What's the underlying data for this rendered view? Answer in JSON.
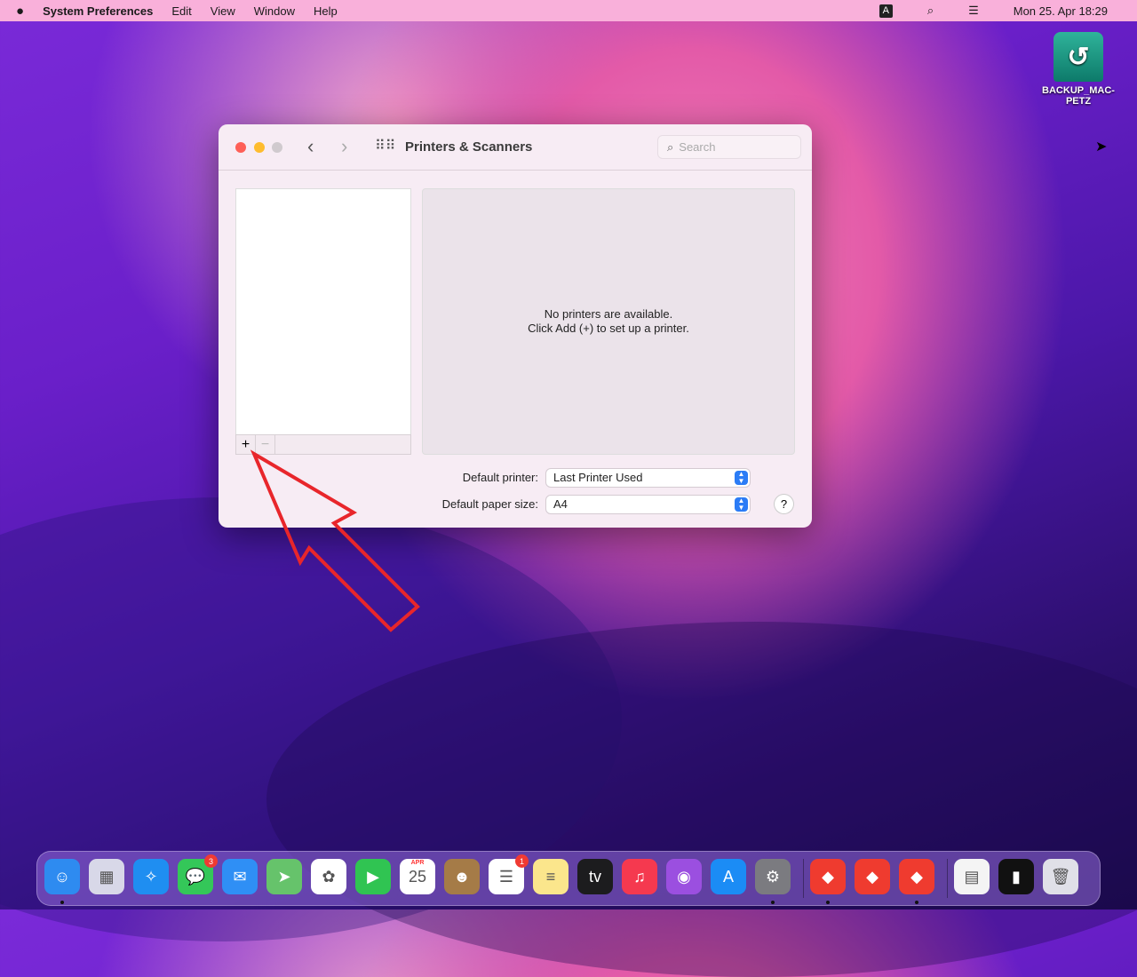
{
  "menubar": {
    "app": "System Preferences",
    "items": [
      "Edit",
      "View",
      "Window",
      "Help"
    ],
    "input_badge": "A",
    "clock": "Mon 25. Apr  18:29"
  },
  "desktop": {
    "drive_label": "BACKUP_MAC-PETZ"
  },
  "window": {
    "title": "Printers & Scanners",
    "search_placeholder": "Search",
    "add_label": "+",
    "remove_label": "−",
    "empty_line1": "No printers are available.",
    "empty_line2": "Click Add (+) to set up a printer.",
    "default_printer_label": "Default printer:",
    "default_printer_value": "Last Printer Used",
    "paper_size_label": "Default paper size:",
    "paper_size_value": "A4",
    "help_label": "?"
  },
  "annotation": {
    "arrow_color": "#e8262b"
  },
  "dock": {
    "items": [
      {
        "name": "finder",
        "glyph": "☺",
        "bg": "#2e8bf0",
        "dot": true
      },
      {
        "name": "launchpad",
        "glyph": "▦",
        "bg": "#d8d8e8"
      },
      {
        "name": "safari",
        "glyph": "✧",
        "bg": "#1f8ef1"
      },
      {
        "name": "messages",
        "glyph": "💬",
        "bg": "#34c759",
        "badge": "3"
      },
      {
        "name": "mail",
        "glyph": "✉",
        "bg": "#2f8ff5"
      },
      {
        "name": "maps",
        "glyph": "➤",
        "bg": "#66c36b"
      },
      {
        "name": "photos",
        "glyph": "✿",
        "bg": "#ffffff"
      },
      {
        "name": "facetime",
        "glyph": "▶",
        "bg": "#30c452"
      },
      {
        "name": "calendar",
        "glyph": "25",
        "bg": "#ffffff",
        "month": "APR"
      },
      {
        "name": "contacts",
        "glyph": "☻",
        "bg": "#a57b47"
      },
      {
        "name": "reminders",
        "glyph": "☰",
        "bg": "#ffffff",
        "badge": "1"
      },
      {
        "name": "notes",
        "glyph": "≡",
        "bg": "#fbe68c"
      },
      {
        "name": "tv",
        "glyph": "tv",
        "bg": "#1c1c1e"
      },
      {
        "name": "music",
        "glyph": "♫",
        "bg": "#f5394f"
      },
      {
        "name": "podcasts",
        "glyph": "◉",
        "bg": "#9b4fe0"
      },
      {
        "name": "app-store",
        "glyph": "A",
        "bg": "#1b8cf5"
      },
      {
        "name": "system-preferences",
        "glyph": "⚙",
        "bg": "#7b7b80",
        "dot": true
      },
      {
        "name": "anydesk-1",
        "glyph": "◆",
        "bg": "#ef3b2f",
        "dot": true
      },
      {
        "name": "anydesk-2",
        "glyph": "◆",
        "bg": "#ef3b2f"
      },
      {
        "name": "anydesk-3",
        "glyph": "◆",
        "bg": "#ef3b2f",
        "dot": true
      },
      {
        "name": "document",
        "glyph": "▤",
        "bg": "#f4f4f4"
      },
      {
        "name": "screenshot",
        "glyph": "▮",
        "bg": "#111111"
      },
      {
        "name": "trash",
        "glyph": "🗑",
        "bg": "#e0e0e8"
      }
    ]
  }
}
